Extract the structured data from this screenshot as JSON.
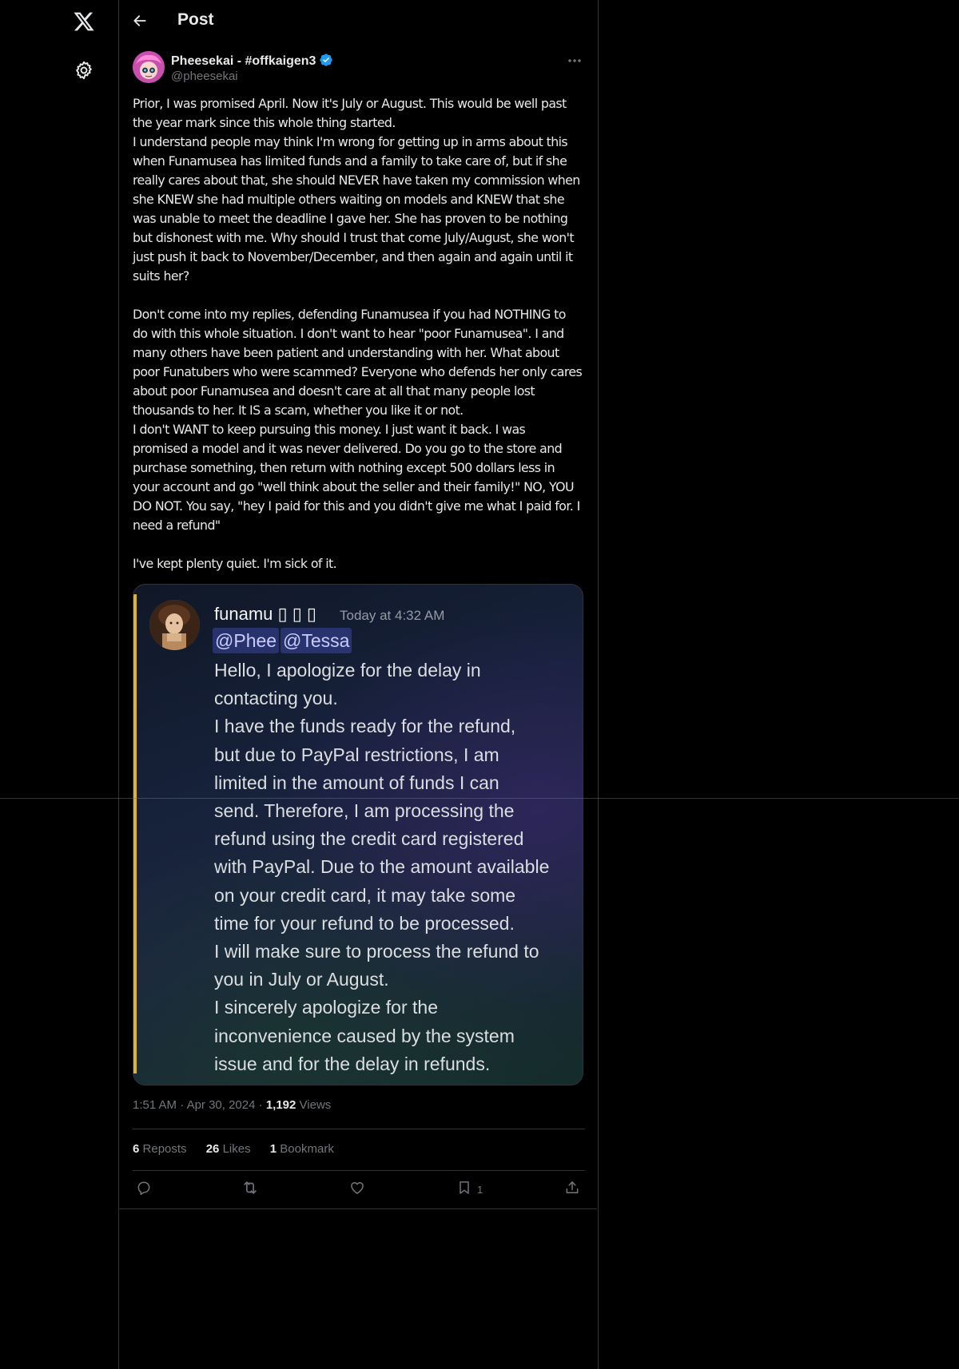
{
  "header": {
    "title": "Post"
  },
  "nav": {
    "logo_icon": "x-logo-icon",
    "settings_icon": "gear-icon"
  },
  "post": {
    "author": {
      "display_name": "Pheesekai - #offkaigen3",
      "handle": "@pheesekai",
      "verified": true
    },
    "text": "Prior, I was promised April. Now it's July or August. This would be well past the year mark since this whole thing started.\nI understand people may think I'm wrong for getting up in arms about this when Funamusea has limited funds and a family to take care of, but if she really cares about that, she should NEVER have taken my commission when she KNEW she had multiple others waiting on models and KNEW that she was unable to meet the deadline I gave her. She has proven to be nothing but dishonest with me. Why should I trust that come July/August, she won't just push it back to November/December, and then again and again until it suits her?\n\nDon't come into my replies, defending Funamusea if you had NOTHING to do with this whole situation. I don't want to hear \"poor Funamusea\". I and many others have been patient and understanding with her. What about poor Funatubers who were scammed? Everyone who defends her only cares about poor Funamusea and doesn't care at all that many people lost thousands to her. It IS a scam, whether you like it or not.\nI don't WANT to keep pursuing this money. I just want it back. I was promised a model and it was never delivered. Do you go to the store and purchase something, then return with nothing except 500 dollars less in your account and go \"well think about the seller and their family!\" NO, YOU DO NOT. You say, \"hey I paid for this and you didn't give me what I paid for. I need a refund\"\n\nI've kept plenty quiet. I'm sick of it.",
    "media": {
      "name": "funamu ▯ ▯ ▯",
      "time": "Today at 4:32 AM",
      "mentions": [
        "@Phee",
        "@Tessa"
      ],
      "message": "Hello, I apologize for the delay in\ncontacting you.\nI have the funds ready for the refund,\nbut due to PayPal restrictions, I am\nlimited in the amount of funds I can\nsend. Therefore, I am processing the\nrefund using the credit card registered\nwith PayPal. Due to the amount available\non your credit card, it may take some\ntime for your refund to be processed.\nI will make sure to process the refund to\nyou in July or August.\nI sincerely apologize for the\ninconvenience caused by the system\nissue and for the delay in refunds.",
      "accent_color": "#e0b234"
    },
    "time": "1:51 AM",
    "separator": "·",
    "date": "Apr 30, 2024",
    "views_count": "1,192",
    "views_label": "Views"
  },
  "stats": {
    "reposts_count": "6",
    "reposts_label": "Reposts",
    "likes_count": "26",
    "likes_label": "Likes",
    "bookmarks_count": "1",
    "bookmarks_label": "Bookmark"
  },
  "actions": {
    "bookmark_count": "1"
  },
  "colors": {
    "background": "#000000",
    "text_primary": "#e7e9ea",
    "text_secondary": "#71767b",
    "border": "#2f3336",
    "verified_blue": "#1d9bf0"
  }
}
